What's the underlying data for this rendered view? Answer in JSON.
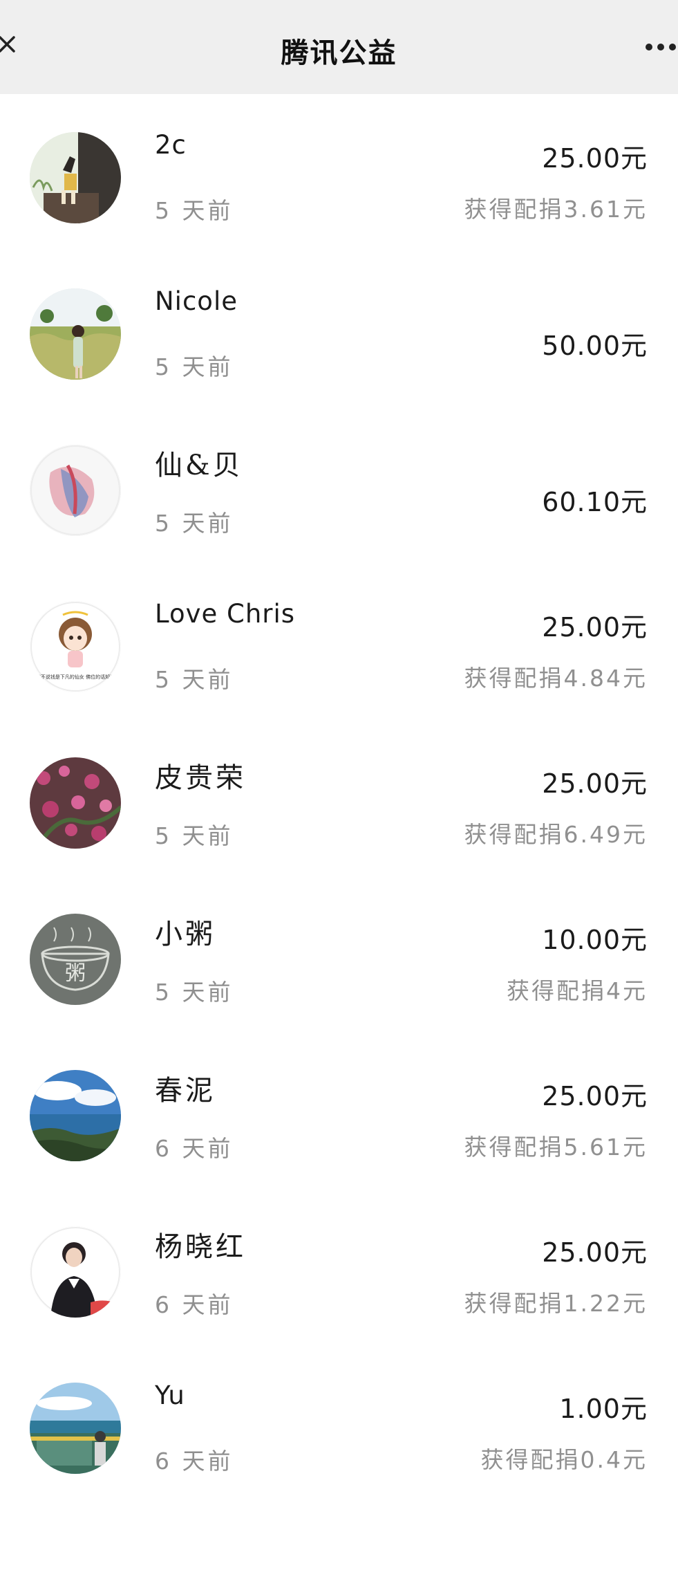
{
  "header": {
    "title": "腾讯公益",
    "close_icon": "close-icon",
    "more_icon": "more-dots-icon"
  },
  "donations": [
    {
      "name": "2c",
      "time": "5 天前",
      "amount": "25.00元",
      "match": "获得配捐3.61元"
    },
    {
      "name": "Nicole",
      "time": "5 天前",
      "amount": "50.00元",
      "match": ""
    },
    {
      "name": "仙&贝",
      "time": "5 天前",
      "amount": "60.10元",
      "match": ""
    },
    {
      "name": "Love Chris",
      "time": "5 天前",
      "amount": "25.00元",
      "match": "获得配捐4.84元",
      "avatar_caption": "做不说钱是下凡的仙女 佛位的话知道"
    },
    {
      "name": "皮贵荣",
      "time": "5 天前",
      "amount": "25.00元",
      "match": "获得配捐6.49元"
    },
    {
      "name": "小粥",
      "time": "5 天前",
      "amount": "10.00元",
      "match": "获得配捐4元",
      "avatar_caption": "粥"
    },
    {
      "name": "春泥",
      "time": "6 天前",
      "amount": "25.00元",
      "match": "获得配捐5.61元"
    },
    {
      "name": "杨晓红",
      "time": "6 天前",
      "amount": "25.00元",
      "match": "获得配捐1.22元"
    },
    {
      "name": "Yu",
      "time": "6 天前",
      "amount": "1.00元",
      "match": "获得配捐0.4元"
    }
  ]
}
